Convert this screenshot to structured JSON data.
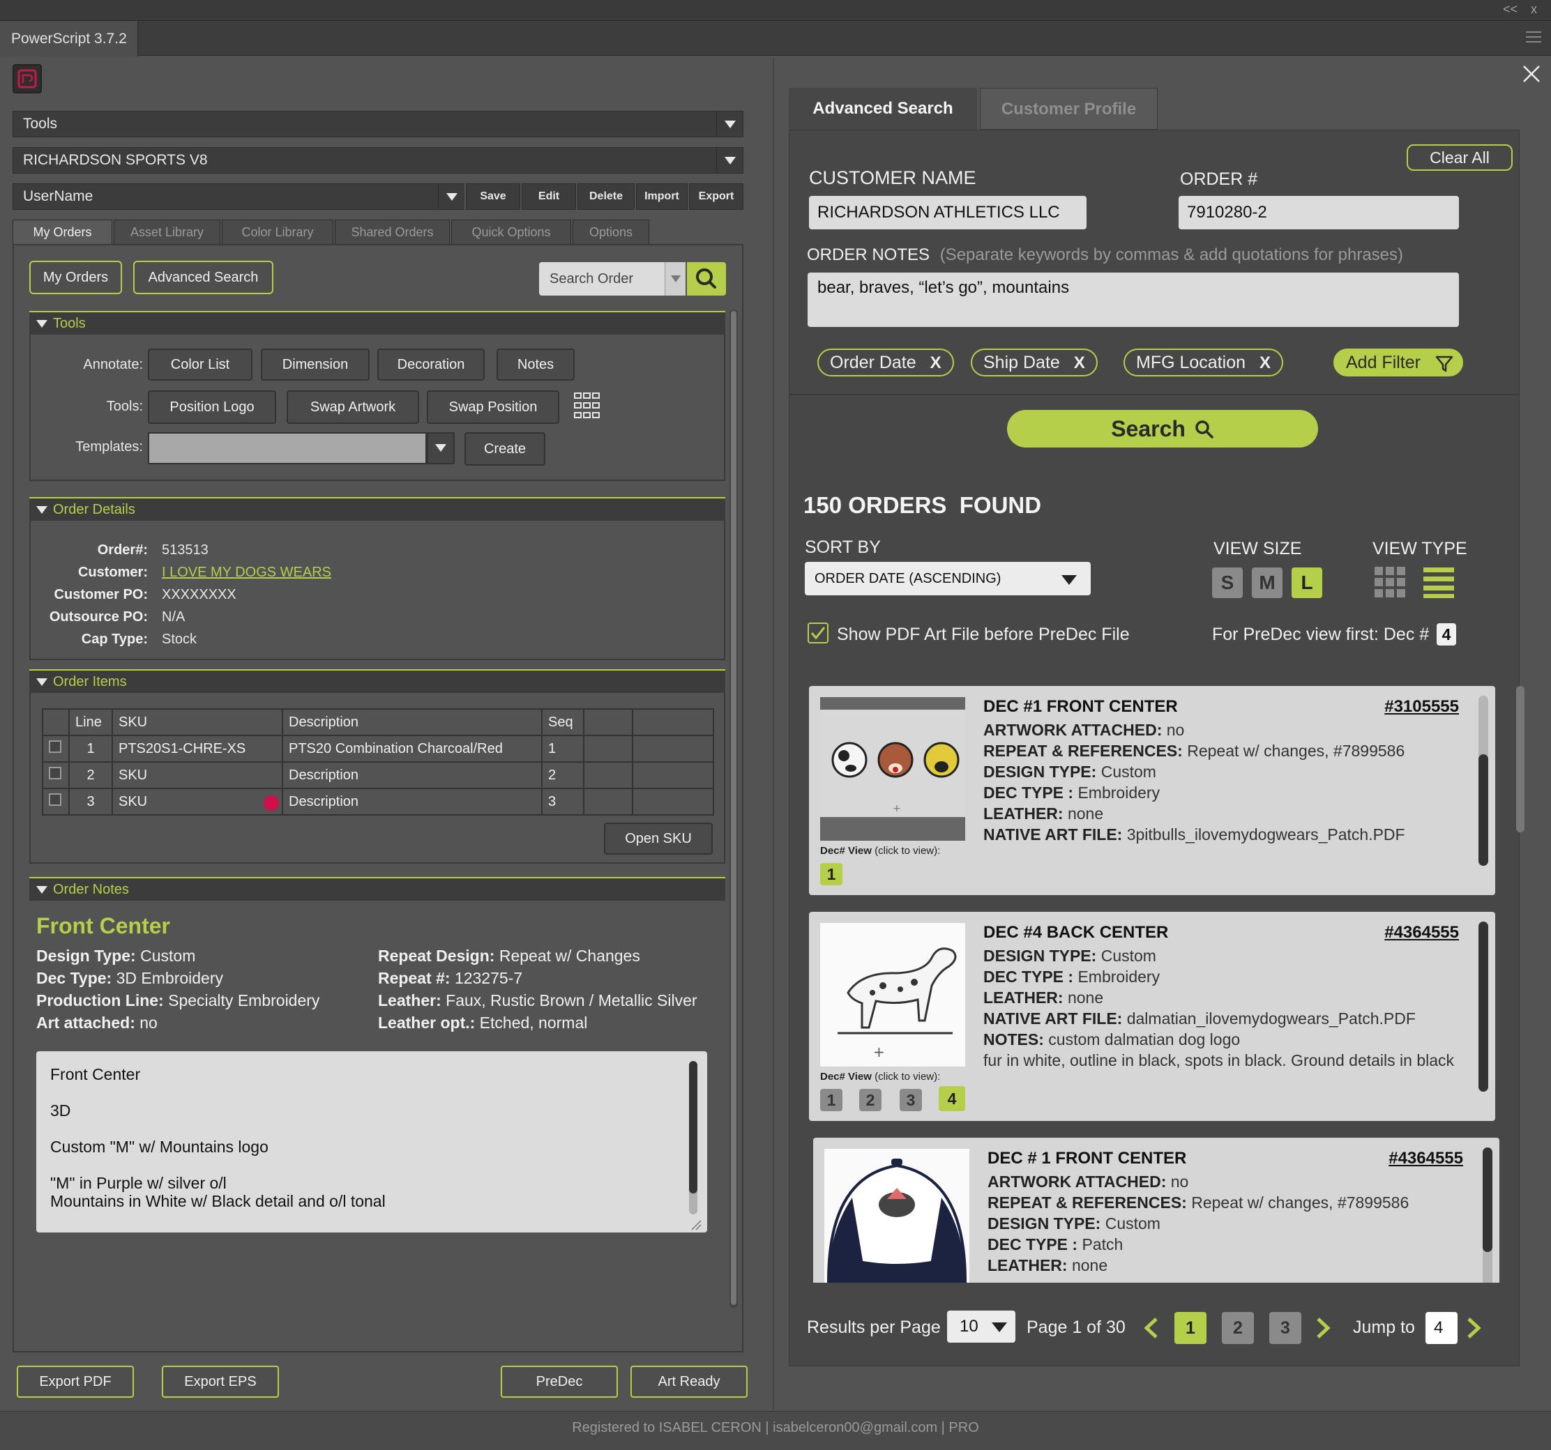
{
  "app": {
    "title": "PowerScript 3.7.2",
    "window_controls": [
      "<<",
      "x"
    ]
  },
  "left": {
    "logo_icon": "app-logo-icon",
    "tools_dropdown": "Tools",
    "company_dropdown": "RICHARDSON SPORTS V8",
    "user_dropdown": "UserName",
    "user_actions": [
      "Save",
      "Edit",
      "Delete",
      "Import",
      "Export"
    ],
    "tabs": [
      "My Orders",
      "Asset Library",
      "Color Library",
      "Shared Orders",
      "Quick Options",
      "Options"
    ],
    "my_orders_button": "My Orders",
    "advanced_search_button": "Advanced Search",
    "search_placeholder": "Search Order",
    "tools_section": {
      "title": "Tools",
      "annotate_label": "Annotate:",
      "annotate_buttons": [
        "Color List",
        "Dimension",
        "Decoration",
        "Notes"
      ],
      "tools_label": "Tools:",
      "tools_buttons": [
        "Position Logo",
        "Swap Artwork",
        "Swap Position"
      ],
      "templates_label": "Templates:",
      "create_button": "Create"
    },
    "order_details": {
      "title": "Order Details",
      "order_label": "Order#:",
      "order": "513513",
      "customer_label": "Customer:",
      "customer": "I LOVE MY DOGS WEARS",
      "po_label": "Customer PO:",
      "po": "XXXXXXXX",
      "outsource_label": "Outsource PO:",
      "outsource": "N/A",
      "cap_label": "Cap Type:",
      "cap": "Stock"
    },
    "order_items": {
      "title": "Order Items",
      "headers": [
        "Line",
        "SKU",
        "Description",
        "Seq"
      ],
      "rows": [
        {
          "line": "1",
          "sku": "PTS20S1-CHRE-XS",
          "desc": "PTS20 Combination Charcoal/Red",
          "seq": "1"
        },
        {
          "line": "2",
          "sku": "SKU",
          "desc": "Description",
          "seq": "2"
        },
        {
          "line": "3",
          "sku": "SKU",
          "desc": "Description",
          "seq": "3"
        }
      ],
      "open_sku_button": "Open SKU"
    },
    "order_notes": {
      "title": "Order Notes",
      "heading": "Front Center",
      "design_type_label": "Design Type:",
      "design_type": "Custom",
      "dec_type_label": "Dec Type:",
      "dec_type": "3D Embroidery",
      "production_label": "Production Line:",
      "production": "Specialty Embroidery",
      "art_label": "Art attached:",
      "art": "no",
      "repeat_design_label": "Repeat Design:",
      "repeat_design": "Repeat w/ Changes",
      "repeat_no_label": "Repeat #:",
      "repeat_no": "123275-7",
      "leather_label": "Leather:",
      "leather": "Faux, Rustic Brown / Metallic Silver",
      "leather_opt_label": "Leather opt.:",
      "leather_opt": "Etched, normal",
      "text_lines": [
        "Front Center",
        "3D",
        "Custom \"M\" w/ Mountains logo",
        "\"M\" in Purple w/ silver o/l",
        "Mountains in White w/ Black detail and o/l tonal"
      ]
    },
    "bottom_buttons": [
      "Export PDF",
      "Export EPS",
      "PreDec",
      "Art Ready"
    ]
  },
  "right": {
    "tabs": [
      "Advanced Search",
      "Customer Profile"
    ],
    "clear_all": "Clear All",
    "customer_name_label": "CUSTOMER NAME",
    "customer_name": "RICHARDSON ATHLETICS LLC",
    "order_label": "ORDER #",
    "order_value": "7910280-2",
    "order_notes_label": "ORDER NOTES",
    "order_notes_hint": "(Separate keywords by commas & add quotations for phrases)",
    "order_notes_value": "bear, braves, “let’s go”, mountains",
    "filters": [
      "Order Date",
      "Ship Date",
      "MFG Location"
    ],
    "filter_remove": "X",
    "add_filter": "Add Filter",
    "search_button": "Search",
    "results_title": "150 ORDERS  FOUND",
    "sort_by_label": "SORT BY",
    "sort_value": "ORDER DATE (ASCENDING)",
    "view_size_label": "VIEW SIZE",
    "view_sizes": [
      "S",
      "M",
      "L"
    ],
    "view_size_selected": "L",
    "view_type_label": "VIEW TYPE",
    "show_pdf_label": "Show PDF Art File before PreDec File",
    "predec_label": "For PreDec view first: Dec #",
    "predec_value": "4",
    "cards": [
      {
        "title": "DEC #1 FRONT CENTER",
        "number": "#3105555",
        "lines": [
          [
            "ARTWORK ATTACHED:",
            " no"
          ],
          [
            "REPEAT & REFERENCES:",
            " Repeat w/ changes, #7899586"
          ],
          [
            "DESIGN TYPE:",
            " Custom"
          ],
          [
            "DEC TYPE :",
            " Embroidery"
          ],
          [
            "LEATHER:",
            " none"
          ],
          [
            "NATIVE ART FILE:",
            " 3pitbulls_ilovemydogwears_Patch.PDF"
          ]
        ],
        "dec_view_label": "Dec# View",
        "dec_view_hint": "(click to view):",
        "decs": [
          "1"
        ],
        "active_dec": "1"
      },
      {
        "title": "DEC #4 BACK CENTER",
        "number": "#4364555",
        "lines": [
          [
            "DESIGN TYPE:",
            " Custom"
          ],
          [
            "DEC TYPE :",
            " Embroidery"
          ],
          [
            "LEATHER:",
            " none"
          ],
          [
            "NATIVE ART FILE:",
            " dalmatian_ilovemydogwears_Patch.PDF"
          ],
          [
            "NOTES:",
            " custom dalmatian dog logo"
          ],
          [
            "",
            "fur in white, outline in black, spots in black. Ground details in black"
          ]
        ],
        "dec_view_label": "Dec# View",
        "dec_view_hint": "(click to view):",
        "decs": [
          "1",
          "2",
          "3",
          "4"
        ],
        "active_dec": "4"
      },
      {
        "title": "DEC # 1 FRONT CENTER",
        "number": "#4364555",
        "lines": [
          [
            "ARTWORK ATTACHED:",
            " no"
          ],
          [
            "REPEAT & REFERENCES:",
            " Repeat w/ changes, #7899586"
          ],
          [
            "DESIGN TYPE:",
            " Custom"
          ],
          [
            "DEC TYPE :",
            " Patch"
          ],
          [
            "LEATHER:",
            " none"
          ]
        ],
        "decs": [],
        "active_dec": ""
      }
    ],
    "results_per_page_label": "Results per Page",
    "results_per_page": "10",
    "page_label": "Page 1 of 30",
    "pages": [
      "1",
      "2",
      "3"
    ],
    "active_page": "1",
    "jump_label": "Jump to",
    "jump_value": "4"
  },
  "footer": "Registered to ISABEL CERON | isabelceron00@gmail.com | PRO",
  "colors": {
    "accent": "#b5cf4a",
    "panel": "#535353",
    "dark": "#3c3c3c"
  }
}
